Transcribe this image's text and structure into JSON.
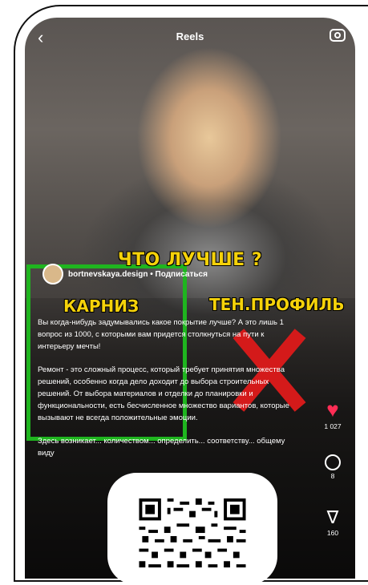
{
  "header": {
    "back_glyph": "‹",
    "title": "Reels",
    "camera_icon": "camera-icon"
  },
  "overlay": {
    "question": "ЧТО ЛУЧШЕ ?",
    "left_label": "КАРНИЗ",
    "right_label": "ТЕН.ПРОФИЛЬ"
  },
  "account": {
    "name": "bortnevskaya.design • Подписаться"
  },
  "caption": {
    "p1": "Вы когда-нибудь задумывались какое покрытие лучше? А это лишь 1 вопрос из 1000, с которыми вам придется столкнуться на пути к интерьеру мечты!",
    "p2": "Ремонт - это сложный процесс, который требует принятия множества решений, особенно когда дело доходит до выбора строительных решений. От выбора материалов и отделки до планировки и функциональности, есть бесчисленное множество вариантов, которые вызывают не всегда положительные эмоции.",
    "p3": "Здесь возникает... количеством... определить... соответству... общему виду"
  },
  "actions": {
    "likes": "1 027",
    "comments": "8",
    "shares": "160"
  },
  "colors": {
    "accent_green": "#1fb51f",
    "accent_red": "#d41a1a",
    "label_yellow": "#f5d20a",
    "like_pink": "#ff2d55"
  }
}
